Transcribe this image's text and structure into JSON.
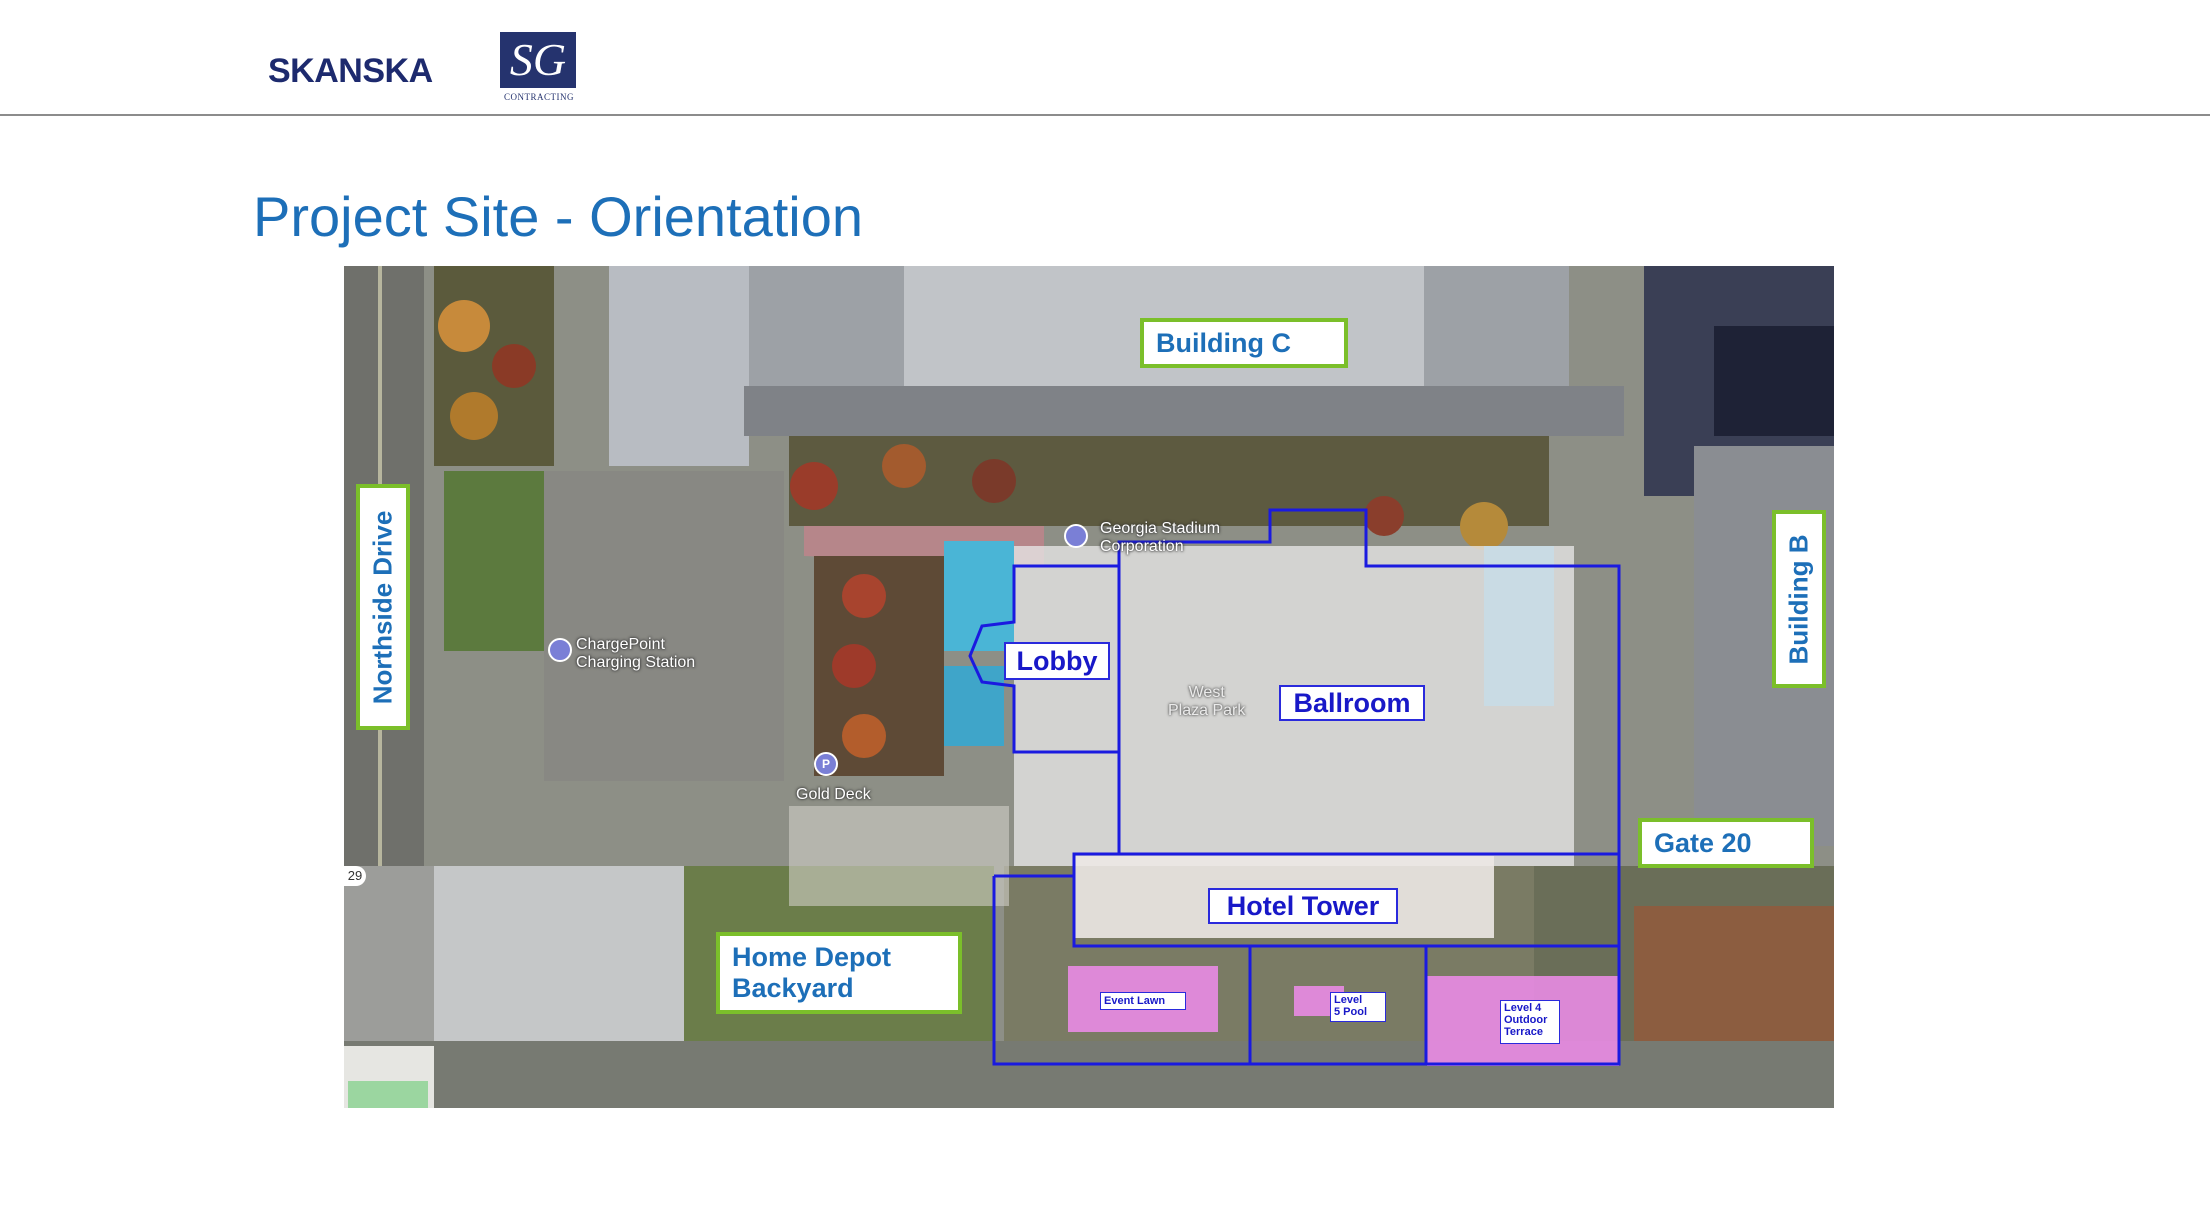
{
  "header": {
    "logo_skanska": "SKANSKA",
    "logo_sg_mark": "SG",
    "logo_sg_sub": "CONTRACTING"
  },
  "title": "Project Site - Orientation",
  "map": {
    "labels": {
      "building_c": "Building C",
      "building_b": "Building B",
      "northside_drive": "Northside Drive",
      "gate_20": "Gate 20",
      "home_depot_line1": "Home Depot",
      "home_depot_line2": "Backyard"
    },
    "zones": {
      "lobby": "Lobby",
      "ballroom": "Ballroom",
      "hotel_tower": "Hotel Tower",
      "event_lawn": "Event Lawn",
      "level5_pool_line1": "Level",
      "level5_pool_line2": "5 Pool",
      "level4_line1": "Level 4",
      "level4_line2": "Outdoor",
      "level4_line3": "Terrace"
    },
    "poi": {
      "georgia_stadium_line1": "Georgia Stadium",
      "georgia_stadium_line2": "Corporation",
      "chargepoint_line1": "ChargePoint",
      "chargepoint_line2": "Charging Station",
      "gold_deck": "Gold Deck",
      "west_plaza_line1": "West",
      "west_plaza_line2": "Plaza Park",
      "parking_pin": "P",
      "route_shield": "29"
    },
    "colors": {
      "zone_outline": "#1a1ae0",
      "label_border": "#7bbf2a",
      "label_text": "#1d6fb8",
      "highlight_pink": "#e98be4"
    }
  }
}
